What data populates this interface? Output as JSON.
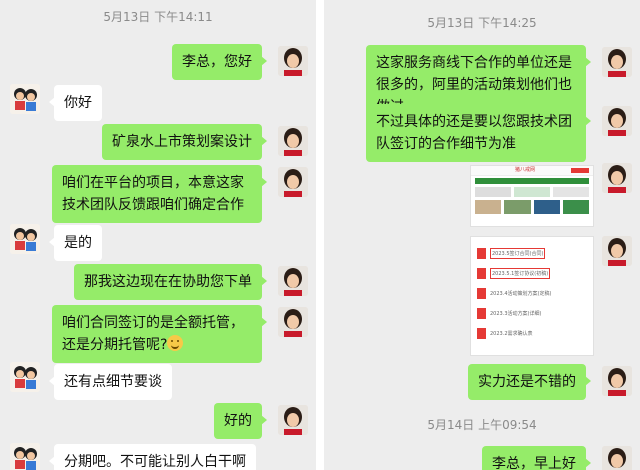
{
  "left": {
    "timestamp": "5月13日 下午14:11",
    "messages": [
      {
        "side": "me",
        "text": "李总，您好"
      },
      {
        "side": "them",
        "text": "你好"
      },
      {
        "side": "me",
        "text": "矿泉水上市策划案设计"
      },
      {
        "side": "me",
        "text": "咱们在平台的项目，本意这家技术团队反馈跟咱们确定合作"
      },
      {
        "side": "them",
        "text": "是的"
      },
      {
        "side": "me",
        "text": "那我这边现在在协助您下单"
      },
      {
        "side": "me",
        "text": "咱们合同签订的是全额托管，还是分期托管呢?"
      },
      {
        "side": "them",
        "text": "还有点细节要谈"
      },
      {
        "side": "me",
        "text": "好的"
      },
      {
        "side": "them",
        "text": "分期吧。不可能让别人白干啊"
      }
    ]
  },
  "right": {
    "timestamp": "5月13日 下午14:25",
    "messages": [
      {
        "side": "me",
        "text": "这家服务商线下合作的单位还是很多的，阿里的活动策划他们也做过"
      },
      {
        "side": "me",
        "text": "不过具体的还是要以您跟技术团队签订的合作细节为准"
      },
      {
        "side": "me",
        "text": "实力还是不错的"
      }
    ],
    "image_card_1": {
      "bar_text": "猪八戒网"
    },
    "image_card_2": {
      "items": [
        "2023.5签订合同(合同)",
        "2023.5.1签订协议(初稿)",
        "2023.4活动策划方案(定稿)",
        "2023.3活动方案(详细)",
        "2023.2需求确认表"
      ]
    },
    "timestamp2": "5月14日 上午09:54",
    "last_message": {
      "side": "me",
      "text": "李总，早上好"
    }
  },
  "colors": {
    "me_bubble": "#95ec69",
    "them_bubble": "#ffffff",
    "bg": "#ededed"
  }
}
